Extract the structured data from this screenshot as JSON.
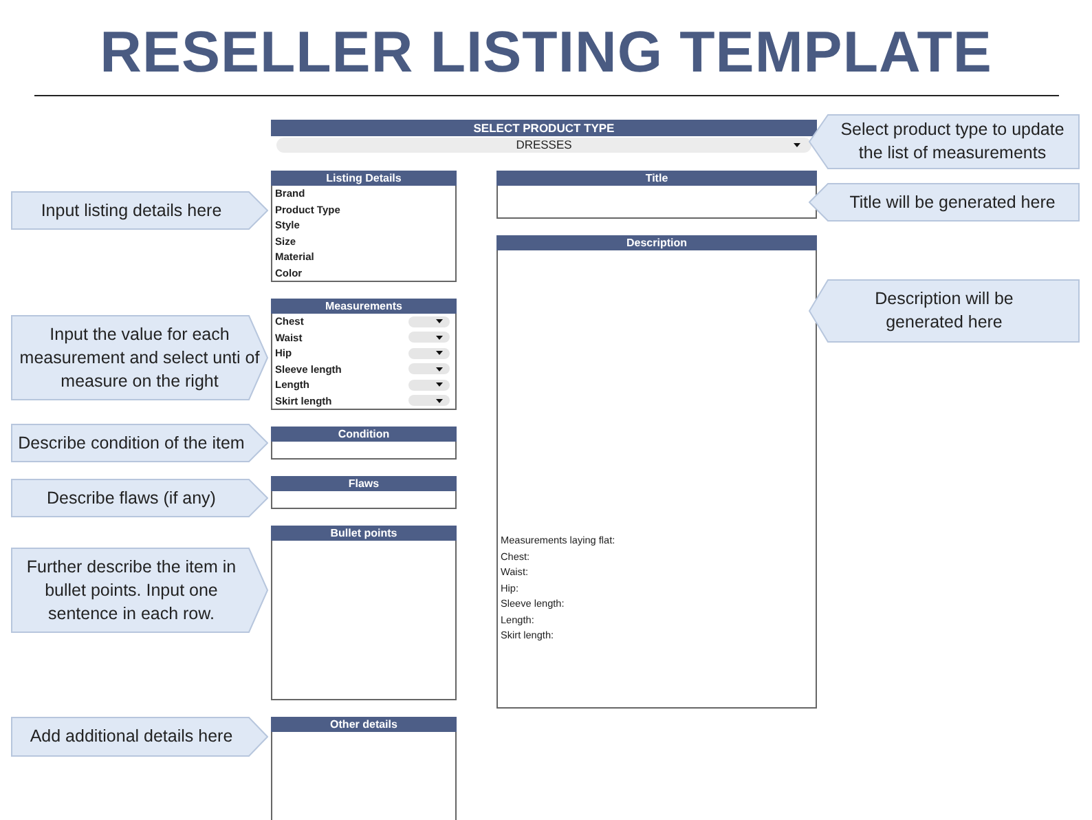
{
  "title": "RESELLER LISTING TEMPLATE",
  "product_type": {
    "header": "SELECT PRODUCT TYPE",
    "value": "DRESSES"
  },
  "listing_details": {
    "header": "Listing Details",
    "fields": [
      "Brand",
      "Product Type",
      "Style",
      "Size",
      "Material",
      "Color"
    ]
  },
  "measurements": {
    "header": "Measurements",
    "fields": [
      "Chest",
      "Waist",
      "Hip",
      "Sleeve length",
      "Length",
      "Skirt length"
    ]
  },
  "condition": {
    "header": "Condition"
  },
  "flaws": {
    "header": "Flaws"
  },
  "bullet_points": {
    "header": "Bullet points"
  },
  "other_details": {
    "header": "Other details"
  },
  "title_panel": {
    "header": "Title"
  },
  "description": {
    "header": "Description",
    "lines": [
      "Measurements laying flat:",
      "Chest:",
      "Waist:",
      "Hip:",
      "Sleeve length:",
      "Length:",
      "Skirt length:"
    ]
  },
  "callouts": [
    {
      "text": "Input listing details here",
      "kind": "left"
    },
    {
      "text": "Input the value for each measurement and select unti of measure on the right",
      "kind": "left"
    },
    {
      "text": "Describe condition of the item",
      "kind": "left"
    },
    {
      "text": "Describe flaws (if any)",
      "kind": "left"
    },
    {
      "text": "Further describe the item in bullet points. Input one sentence in each row.",
      "kind": "left"
    },
    {
      "text": "Add additional details here",
      "kind": "left"
    },
    {
      "text": "Select product type to update the list of measurements",
      "kind": "right"
    },
    {
      "text": "Title will be generated here",
      "kind": "right"
    },
    {
      "text": "Description will be generated here",
      "kind": "right"
    }
  ]
}
